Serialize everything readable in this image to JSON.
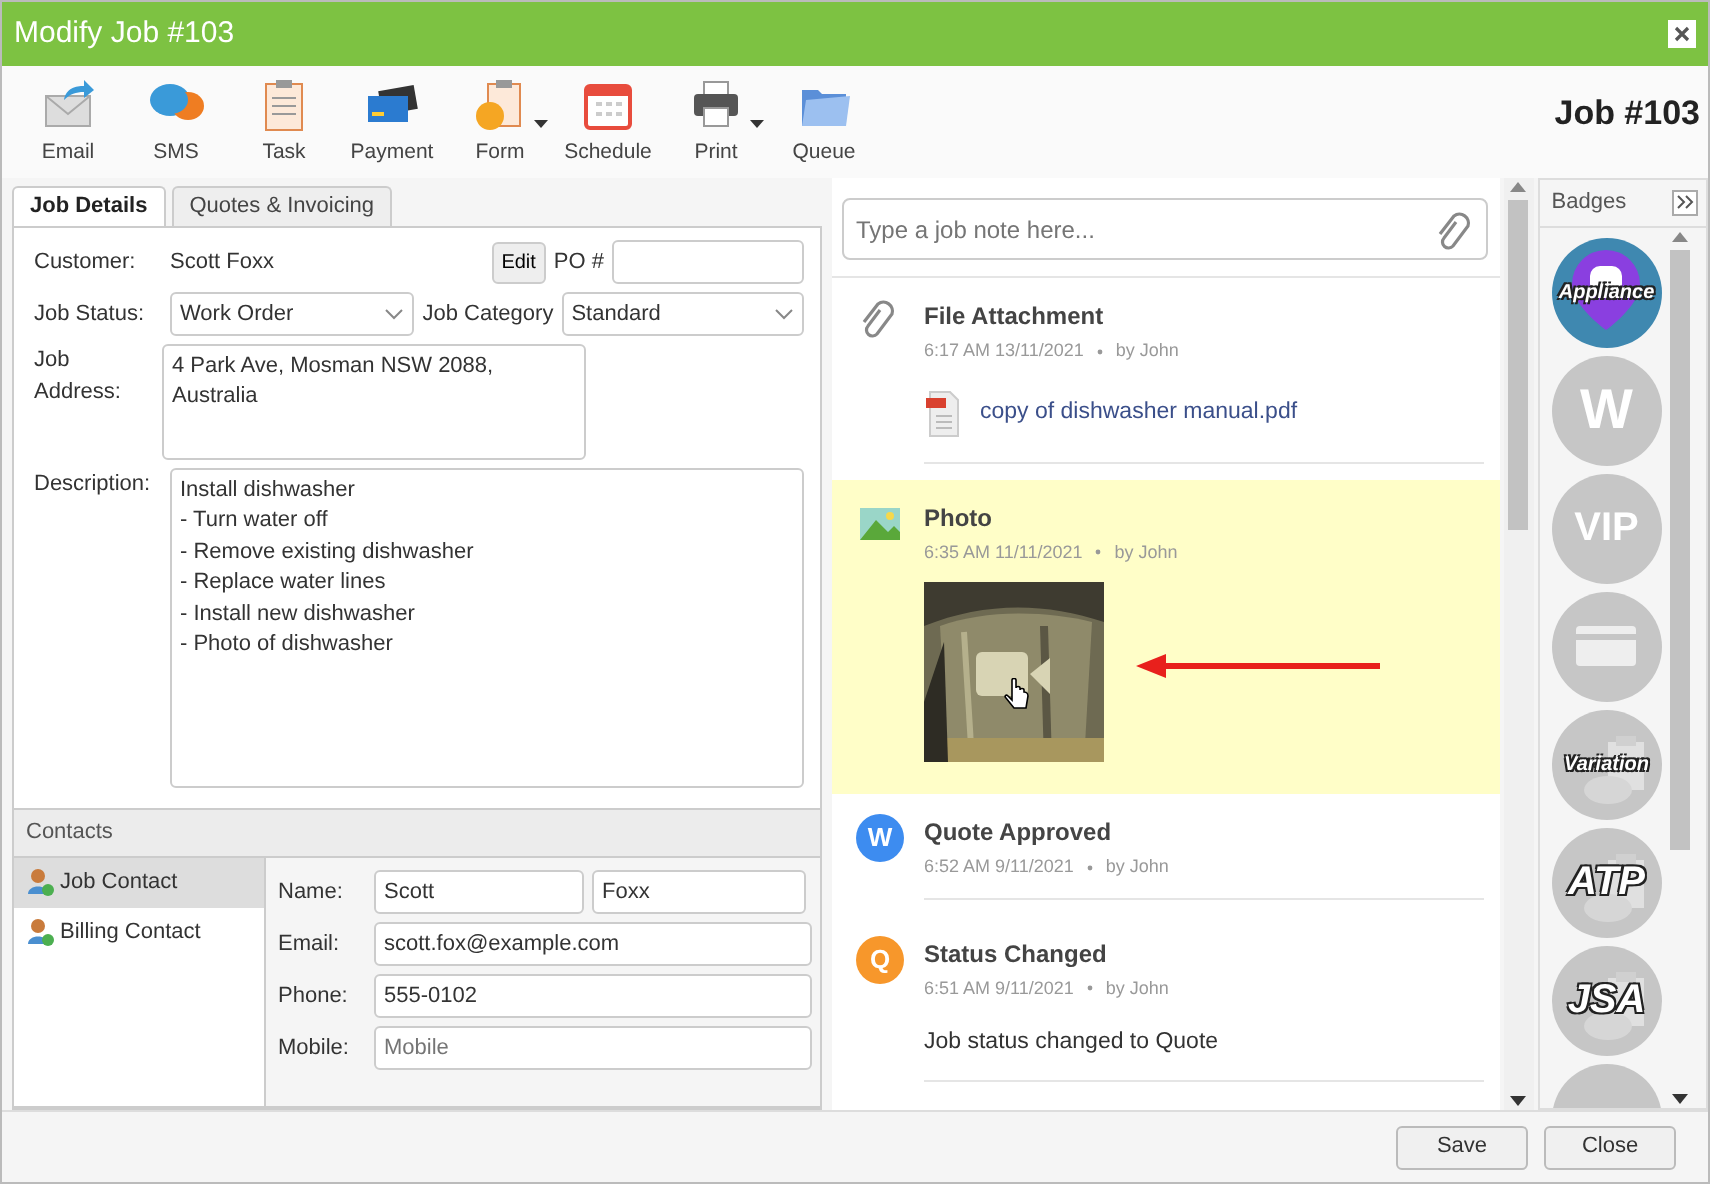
{
  "window": {
    "title": "Modify Job #103"
  },
  "toolbar": [
    {
      "label": "Email",
      "kind": "email",
      "dropdown": false
    },
    {
      "label": "SMS",
      "kind": "sms",
      "dropdown": false
    },
    {
      "label": "Task",
      "kind": "task",
      "dropdown": false
    },
    {
      "label": "Payment",
      "kind": "payment",
      "dropdown": false
    },
    {
      "label": "Form",
      "kind": "form",
      "dropdown": true
    },
    {
      "label": "Schedule",
      "kind": "schedule",
      "dropdown": false
    },
    {
      "label": "Print",
      "kind": "print",
      "dropdown": true
    },
    {
      "label": "Queue",
      "kind": "queue",
      "dropdown": false
    }
  ],
  "job_heading": "Job #103",
  "tabs": [
    {
      "label": "Job Details",
      "selected": true
    },
    {
      "label": "Quotes & Invoicing",
      "selected": false
    }
  ],
  "details": {
    "customer_label": "Customer:",
    "customer": "Scott Foxx",
    "edit_button": "Edit",
    "po_label": "PO #",
    "status_label": "Job Status:",
    "status": "Work Order",
    "category_label": "Job Category",
    "category": "Standard",
    "address_label": "Job Address:",
    "address": "4 Park Ave, Mosman NSW 2088,\nAustralia",
    "description_label": "Description:",
    "description": "Install dishwasher\n- Turn water off\n- Remove existing dishwasher\n- Replace water lines\n- Install new dishwasher\n- Photo of dishwasher"
  },
  "contacts": {
    "title": "Contacts",
    "items": [
      {
        "label": "Job Contact",
        "selected": true
      },
      {
        "label": "Billing Contact",
        "selected": false
      }
    ],
    "name_label": "Name:",
    "first_name": "Scott",
    "last_name": "Foxx",
    "email_label": "Email:",
    "email": "scott.fox@example.com",
    "phone_label": "Phone:",
    "phone": "555-0102",
    "mobile_label": "Mobile:",
    "mobile_placeholder": "Mobile"
  },
  "notes": {
    "placeholder": "Type a job note here...",
    "entries": [
      {
        "kind": "attachment",
        "title": "File Attachment",
        "time": "6:17 AM 13/11/2021",
        "author": "by John",
        "highlighted": false,
        "file": "copy of dishwasher manual.pdf"
      },
      {
        "title": "Photo",
        "time": "6:35 AM 11/11/2021",
        "author": "by John",
        "highlighted": true
      },
      {
        "kind": "avatar",
        "letter": "W",
        "color": "#3d8cf0",
        "title": "Quote Approved",
        "time": "6:52 AM 9/11/2021",
        "author": "by John",
        "highlighted": false
      },
      {
        "kind": "avatar",
        "letter": "Q",
        "color": "#f7972b",
        "title": "Status Changed",
        "time": "6:51 AM 9/11/2021",
        "author": "by John",
        "highlighted": false,
        "text": "Job status changed to Quote"
      }
    ]
  },
  "badges": {
    "title": "Badges",
    "items": [
      {
        "kind": "pin",
        "label": "Appliance",
        "active": true
      },
      {
        "kind": "text",
        "label": "W",
        "active": false
      },
      {
        "kind": "text",
        "label": "VIP",
        "active": false
      },
      {
        "kind": "card",
        "active": false
      },
      {
        "kind": "clipboard",
        "label": "Variation",
        "active": false
      },
      {
        "kind": "clipboard",
        "label": "ATP",
        "active": false
      },
      {
        "kind": "clipboard",
        "label": "JSA",
        "active": false
      },
      {
        "kind": "plain",
        "active": false
      }
    ]
  },
  "footer": {
    "buttons": [
      "Save",
      "Close"
    ]
  }
}
